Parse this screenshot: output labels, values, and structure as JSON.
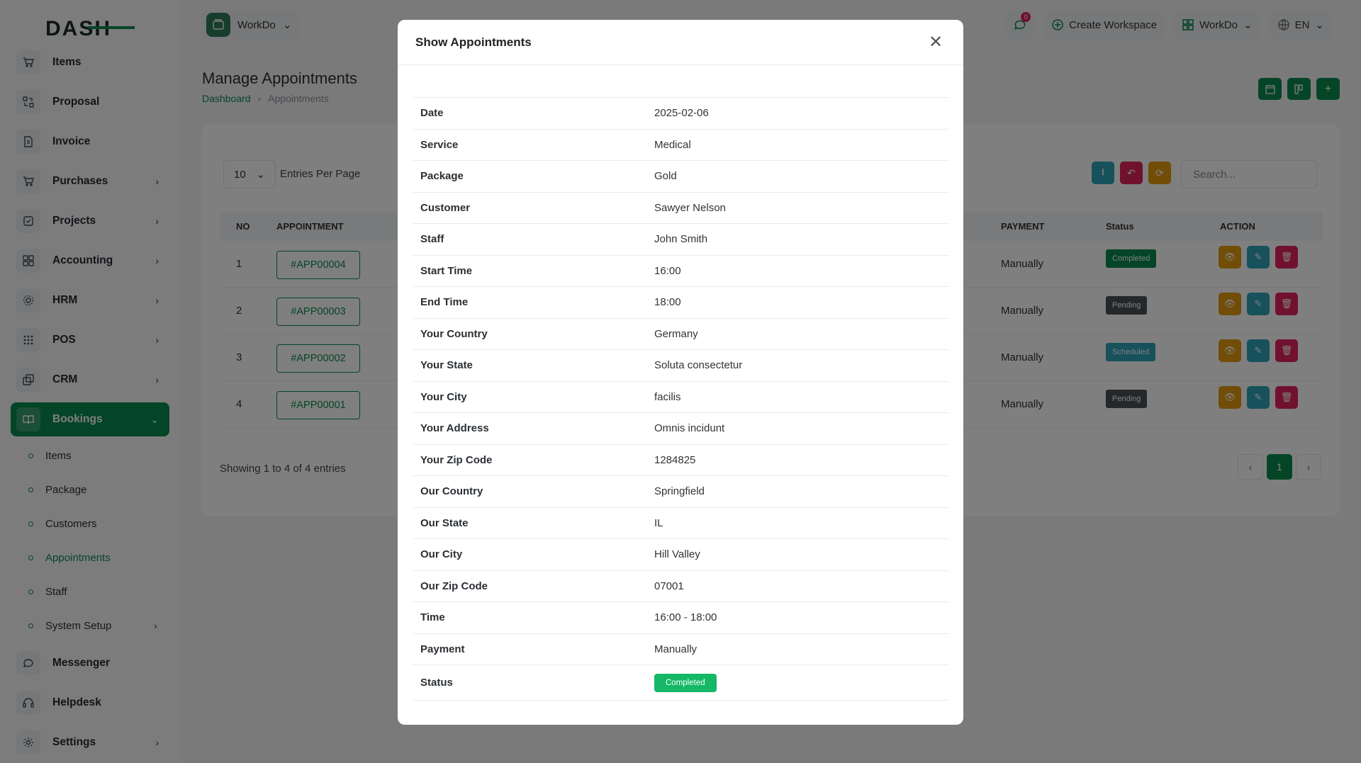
{
  "brand": {
    "logo_text": "DASH"
  },
  "sidebar": {
    "items": [
      {
        "label": "Items",
        "icon": "cart-icon",
        "has_children": false
      },
      {
        "label": "Proposal",
        "icon": "proposal-icon",
        "has_children": false
      },
      {
        "label": "Invoice",
        "icon": "invoice-icon",
        "has_children": false
      },
      {
        "label": "Purchases",
        "icon": "cart-icon",
        "has_children": true
      },
      {
        "label": "Projects",
        "icon": "checklist-icon",
        "has_children": true
      },
      {
        "label": "Accounting",
        "icon": "grid-icon",
        "has_children": true
      },
      {
        "label": "HRM",
        "icon": "people-icon",
        "has_children": true
      },
      {
        "label": "POS",
        "icon": "dots-grid-icon",
        "has_children": true
      },
      {
        "label": "CRM",
        "icon": "layers-icon",
        "has_children": true
      },
      {
        "label": "Bookings",
        "icon": "book-icon",
        "has_children": true,
        "active": true
      }
    ],
    "bookings_sub": [
      {
        "label": "Items"
      },
      {
        "label": "Package"
      },
      {
        "label": "Customers"
      },
      {
        "label": "Appointments",
        "active": true
      },
      {
        "label": "Staff"
      },
      {
        "label": "System Setup",
        "has_children": true
      }
    ],
    "bottom_items": [
      {
        "label": "Messenger",
        "icon": "chat-icon"
      },
      {
        "label": "Helpdesk",
        "icon": "headset-icon"
      },
      {
        "label": "Settings",
        "icon": "gear-icon",
        "has_children": true
      }
    ]
  },
  "topbar": {
    "workspace_label": "WorkDo",
    "notification_count": "0",
    "create_workspace_label": "Create Workspace",
    "workspace_menu_label": "WorkDo",
    "language": "EN"
  },
  "page": {
    "title": "Manage Appointments",
    "breadcrumb": [
      "Dashboard",
      "Appointments"
    ]
  },
  "table": {
    "entries_value": "10",
    "entries_label": "Entries Per Page",
    "search_placeholder": "Search...",
    "columns": {
      "no": "NO",
      "appointment": "APPOINTMENT",
      "payment": "PAYMENT",
      "status": "Status",
      "action": "ACTION"
    },
    "rows": [
      {
        "no": "1",
        "appointment": "#APP00004",
        "payment": "Manually",
        "status": "Completed",
        "status_color": "#0b8a4e"
      },
      {
        "no": "2",
        "appointment": "#APP00003",
        "payment": "Manually",
        "status": "Pending",
        "status_color": "#4a5057"
      },
      {
        "no": "3",
        "appointment": "#APP00002",
        "payment": "Manually",
        "status": "Scheduled",
        "status_color": "#2fa3b8"
      },
      {
        "no": "4",
        "appointment": "#APP00001",
        "payment": "Manually",
        "status": "Pending",
        "status_color": "#4a5057"
      }
    ],
    "showing_text": "Showing 1 to 4 of 4 entries",
    "current_page": "1"
  },
  "modal": {
    "title": "Show Appointments",
    "details": [
      {
        "label": "Date",
        "value": "2025-02-06"
      },
      {
        "label": "Service",
        "value": "Medical"
      },
      {
        "label": "Package",
        "value": "Gold"
      },
      {
        "label": "Customer",
        "value": "Sawyer Nelson"
      },
      {
        "label": "Staff",
        "value": "John Smith"
      },
      {
        "label": "Start Time",
        "value": "16:00"
      },
      {
        "label": "End Time",
        "value": "18:00"
      },
      {
        "label": "Your Country",
        "value": "Germany"
      },
      {
        "label": "Your State",
        "value": "Soluta consectetur"
      },
      {
        "label": "Your City",
        "value": "facilis"
      },
      {
        "label": "Your Address",
        "value": "Omnis incidunt"
      },
      {
        "label": "Your Zip Code",
        "value": "1284825"
      },
      {
        "label": "Our Country",
        "value": "Springfield"
      },
      {
        "label": "Our State",
        "value": "IL"
      },
      {
        "label": "Our City",
        "value": "Hill Valley"
      },
      {
        "label": "Our Zip Code",
        "value": "07001"
      },
      {
        "label": "Time",
        "value": "16:00 - 18:00"
      },
      {
        "label": "Payment",
        "value": "Manually"
      }
    ],
    "status_label": "Status",
    "status_value": "Completed"
  },
  "colors": {
    "primary": "#0b8a4e",
    "danger": "#e0245e",
    "warning": "#e29b0f",
    "info": "#2fa3b8",
    "success": "#14b866"
  }
}
